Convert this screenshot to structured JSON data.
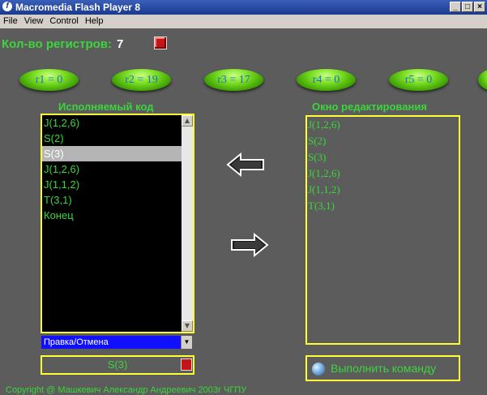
{
  "window": {
    "title": "Macromedia Flash Player 8",
    "controls": [
      "_",
      "□",
      "×"
    ]
  },
  "menu": {
    "items": [
      "File",
      "View",
      "Control",
      "Help"
    ]
  },
  "registers": {
    "count_label": "Кол-во регистров:",
    "count_value": "7",
    "pills": [
      "r1 = 0",
      "r2 = 19",
      "r3 = 17",
      "r4 = 0",
      "r5 = 0"
    ]
  },
  "left_panel": {
    "heading": "Исполняемый код",
    "items": [
      "J(1,2,6)",
      "S(2)",
      "S(3)",
      "J(1,2,6)",
      "J(1,1,2)",
      "T(3,1)",
      "Конец"
    ],
    "selected_index": 2
  },
  "right_panel": {
    "heading": "Окно редактирования",
    "items": [
      "J(1,2,6)",
      "S(2)",
      "S(3)",
      "J(1,2,6)",
      "J(1,1,2)",
      "T(3,1)"
    ]
  },
  "dropdown": {
    "selected": "Правка/Отмена"
  },
  "current_command": "S(3)",
  "execute_button": "Выполнить команду",
  "copyright": "Copyright @ Машкевич Александр Андреевич 2003г ЧГПУ",
  "colors": {
    "background": "#5c5c5c",
    "accent_green": "#3bd63b",
    "border_yellow": "#ffff33",
    "pill_text_blue": "#1f6fd9",
    "dropdown_blue": "#1010ff"
  },
  "icons": {
    "left_arrow": "left-arrow-icon",
    "right_arrow": "right-arrow-icon",
    "execute": "blue-ball-icon"
  }
}
